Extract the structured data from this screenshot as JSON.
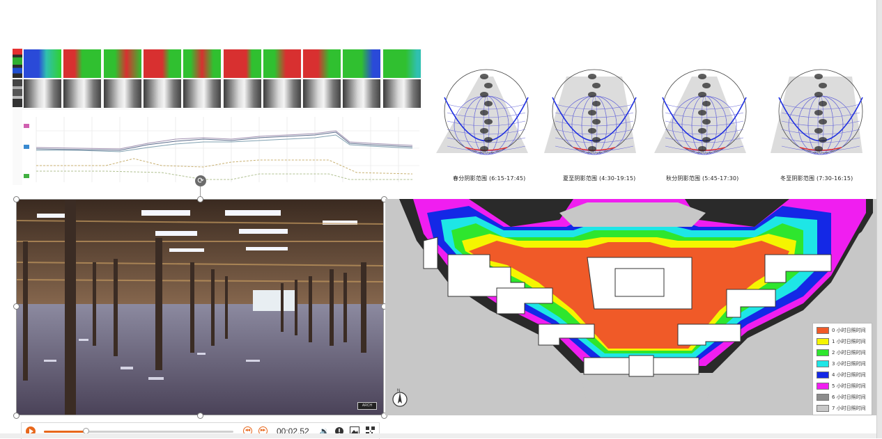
{
  "sun_captions": [
    "春分阴影范围 (6:15-17:45)",
    "夏至阴影范围 (4:30-19:15)",
    "秋分阴影范围 (5:45-17:30)",
    "冬至阴影范围 (7:30-16:15)"
  ],
  "player": {
    "time": "00:02.52",
    "progress": 0.22
  },
  "legend": [
    {
      "label": "0 小时日照时间",
      "color": "#f05a28"
    },
    {
      "label": "1 小时日照时间",
      "color": "#f5f500"
    },
    {
      "label": "2 小时日照时间",
      "color": "#2ee62e"
    },
    {
      "label": "3 小时日照时间",
      "color": "#1ee6e6"
    },
    {
      "label": "4 小时日照时间",
      "color": "#1428e6"
    },
    {
      "label": "5 小时日照时间",
      "color": "#f01ef0"
    },
    {
      "label": "6 小时日照时间",
      "color": "#8c8c8c"
    },
    {
      "label": "7 小时日照时间",
      "color": "#c8c8c8"
    }
  ],
  "colors": {
    "accent": "#e8671b"
  }
}
